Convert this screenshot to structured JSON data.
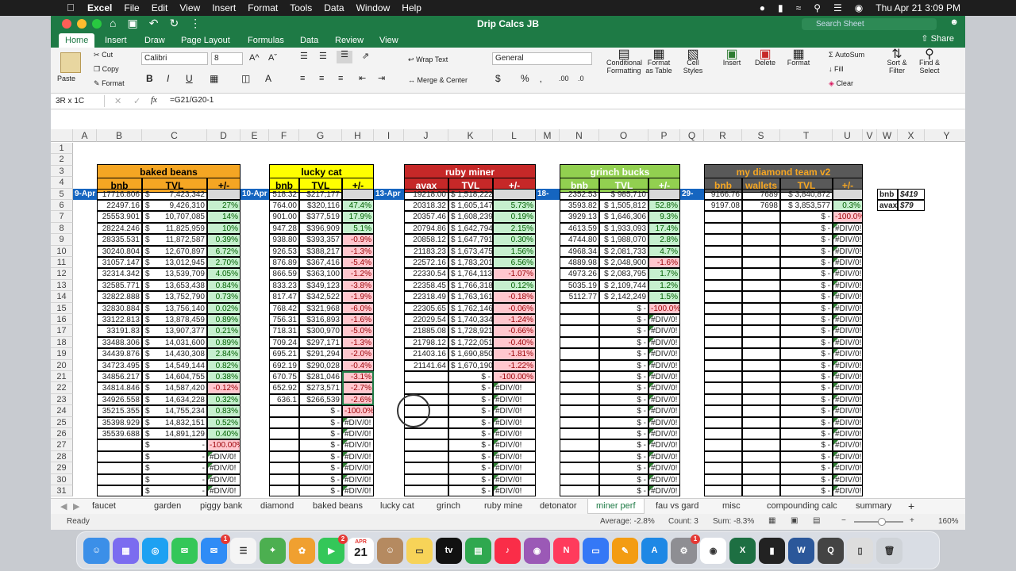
{
  "menubar": {
    "apple": "",
    "app_name": "Excel",
    "items": [
      "File",
      "Edit",
      "View",
      "Insert",
      "Format",
      "Tools",
      "Data",
      "Window",
      "Help"
    ],
    "datetime": "Thu Apr 21  3:09 PM"
  },
  "window": {
    "title": "Drip Calcs JB",
    "search_placeholder": "Search Sheet",
    "share_label": "Share"
  },
  "ribbon_tabs": [
    "Home",
    "Insert",
    "Draw",
    "Page Layout",
    "Formulas",
    "Data",
    "Review",
    "View"
  ],
  "ribbon": {
    "paste": "Paste",
    "cut": "Cut",
    "copy": "Copy",
    "format": "Format",
    "font_name": "Calibri",
    "font_size": "8",
    "wrap_text": "Wrap Text",
    "merge_center": "Merge & Center",
    "number_format": "General",
    "conditional_formatting": "Conditional Formatting",
    "format_as_table": "Format as Table",
    "cell_styles": "Cell Styles",
    "insert": "Insert",
    "delete": "Delete",
    "format2": "Format",
    "autosum": "AutoSum",
    "fill": "Fill",
    "clear": "Clear",
    "sort_filter": "Sort & Filter",
    "find_select": "Find & Select"
  },
  "formula_bar": {
    "name_box": "3R x 1C",
    "fx": "fx",
    "formula": "=G21/G20-1"
  },
  "columns": [
    "A",
    "B",
    "C",
    "D",
    "E",
    "F",
    "G",
    "H",
    "I",
    "J",
    "K",
    "L",
    "M",
    "N",
    "O",
    "P",
    "Q",
    "R",
    "S",
    "T",
    "U",
    "V",
    "W",
    "X",
    "Y"
  ],
  "rows": [
    "1",
    "2",
    "3",
    "4",
    "5",
    "6",
    "7",
    "8",
    "9",
    "10",
    "11",
    "12",
    "13",
    "14",
    "15",
    "16",
    "17",
    "18",
    "19",
    "20",
    "21",
    "22",
    "23",
    "24",
    "25",
    "26",
    "27",
    "28",
    "29",
    "30",
    "31"
  ],
  "blocks": {
    "baked_beans": {
      "title": "baked beans",
      "headers": [
        "bnb",
        "TVL",
        "+/-"
      ],
      "date": "9-Apr",
      "rows": [
        [
          "17716.806",
          "7,423,342",
          ""
        ],
        [
          "22497.16",
          "9,426,310",
          "27%"
        ],
        [
          "25553.901",
          "10,707,085",
          "14%"
        ],
        [
          "28224.246",
          "11,825,959",
          "10%"
        ],
        [
          "28335.531",
          "11,872,587",
          "0.39%"
        ],
        [
          "30240.804",
          "12,670,897",
          "6.72%"
        ],
        [
          "31057.147",
          "13,012,945",
          "2.70%"
        ],
        [
          "32314.342",
          "13,539,709",
          "4.05%"
        ],
        [
          "32585.771",
          "13,653,438",
          "0.84%"
        ],
        [
          "32822.888",
          "13,752,790",
          "0.73%"
        ],
        [
          "32830.884",
          "13,756,140",
          "0.02%"
        ],
        [
          "33122.813",
          "13,878,459",
          "0.89%"
        ],
        [
          "33191.83",
          "13,907,377",
          "0.21%"
        ],
        [
          "33488.306",
          "14,031,600",
          "0.89%"
        ],
        [
          "34439.876",
          "14,430,308",
          "2.84%"
        ],
        [
          "34723.495",
          "14,549,144",
          "0.82%"
        ],
        [
          "34856.217",
          "14,604,755",
          "0.38%"
        ],
        [
          "34814.846",
          "14,587,420",
          "-0.12%"
        ],
        [
          "34926.558",
          "14,634,228",
          "0.32%"
        ],
        [
          "35215.355",
          "14,755,234",
          "0.83%"
        ],
        [
          "35398.929",
          "14,832,151",
          "0.52%"
        ],
        [
          "35539.688",
          "14,891,129",
          "0.40%"
        ],
        [
          "",
          "-",
          "-100.00%"
        ],
        [
          "",
          "-",
          "#DIV/0!"
        ],
        [
          "",
          "-",
          "#DIV/0!"
        ],
        [
          "",
          "-",
          "#DIV/0!"
        ],
        [
          "",
          "-",
          "#DIV/0!"
        ]
      ]
    },
    "lucky_cat": {
      "title": "lucky cat",
      "headers": [
        "bnb",
        "TVL",
        "+/-"
      ],
      "date": "10-Apr",
      "rows": [
        [
          "518.32",
          "$217,177",
          ""
        ],
        [
          "764.00",
          "$320,116",
          "47.4%"
        ],
        [
          "901.00",
          "$377,519",
          "17.9%"
        ],
        [
          "947.28",
          "$396,909",
          "5.1%"
        ],
        [
          "938.80",
          "$393,357",
          "-0.9%"
        ],
        [
          "926.53",
          "$388,217",
          "-1.3%"
        ],
        [
          "876.89",
          "$367,416",
          "-5.4%"
        ],
        [
          "866.59",
          "$363,100",
          "-1.2%"
        ],
        [
          "833.23",
          "$349,123",
          "-3.8%"
        ],
        [
          "817.47",
          "$342,522",
          "-1.9%"
        ],
        [
          "768.42",
          "$321,968",
          "-6.0%"
        ],
        [
          "756.31",
          "$316,893",
          "-1.6%"
        ],
        [
          "718.31",
          "$300,970",
          "-5.0%"
        ],
        [
          "709.24",
          "$297,171",
          "-1.3%"
        ],
        [
          "695.21",
          "$291,294",
          "-2.0%"
        ],
        [
          "692.19",
          "$290,028",
          "-0.4%"
        ],
        [
          "670.75",
          "$281,046",
          "-3.1%"
        ],
        [
          "652.92",
          "$273,571",
          "-2.7%"
        ],
        [
          "636.1",
          "$266,539",
          "-2.6%"
        ],
        [
          "",
          "$ -",
          "-100.0%"
        ],
        [
          "",
          "$ -",
          "#DIV/0!"
        ],
        [
          "",
          "$ -",
          "#DIV/0!"
        ],
        [
          "",
          "$ -",
          "#DIV/0!"
        ],
        [
          "",
          "$ -",
          "#DIV/0!"
        ],
        [
          "",
          "$ -",
          "#DIV/0!"
        ],
        [
          "",
          "$ -",
          "#DIV/0!"
        ],
        [
          "",
          "$ -",
          "#DIV/0!"
        ]
      ]
    },
    "ruby_miner": {
      "title": "ruby miner",
      "headers": [
        "avax",
        "TVL",
        "+/-"
      ],
      "date": "13-Apr",
      "rows": [
        [
          "19218.00",
          "$ 1,518,222",
          ""
        ],
        [
          "20318.32",
          "$ 1,605,147",
          "5.73%"
        ],
        [
          "20357.46",
          "$ 1,608,239",
          "0.19%"
        ],
        [
          "20794.86",
          "$ 1,642,794",
          "2.15%"
        ],
        [
          "20858.12",
          "$ 1,647,791",
          "0.30%"
        ],
        [
          "21183.23",
          "$ 1,673,475",
          "1.56%"
        ],
        [
          "22572.16",
          "$ 1,783,201",
          "6.56%"
        ],
        [
          "22330.54",
          "$ 1,764,113",
          "-1.07%"
        ],
        [
          "22358.45",
          "$ 1,766,318",
          "0.12%"
        ],
        [
          "22318.49",
          "$ 1,763,161",
          "-0.18%"
        ],
        [
          "22305.65",
          "$ 1,762,146",
          "-0.06%"
        ],
        [
          "22029.54",
          "$ 1,740,334",
          "-1.24%"
        ],
        [
          "21885.08",
          "$ 1,728,921",
          "-0.66%"
        ],
        [
          "21798.12",
          "$ 1,722,051",
          "-0.40%"
        ],
        [
          "21403.16",
          "$ 1,690,850",
          "-1.81%"
        ],
        [
          "21141.64",
          "$ 1,670,190",
          "-1.22%"
        ],
        [
          "",
          "$ -",
          "-100.00%"
        ],
        [
          "",
          "$ -",
          "#DIV/0!"
        ],
        [
          "",
          "$ -",
          "#DIV/0!"
        ],
        [
          "",
          "$ -",
          "#DIV/0!"
        ],
        [
          "",
          "$ -",
          "#DIV/0!"
        ],
        [
          "",
          "$ -",
          "#DIV/0!"
        ],
        [
          "",
          "$ -",
          "#DIV/0!"
        ],
        [
          "",
          "$ -",
          "#DIV/0!"
        ],
        [
          "",
          "$ -",
          "#DIV/0!"
        ],
        [
          "",
          "$ -",
          "#DIV/0!"
        ],
        [
          "",
          "$ -",
          "#DIV/0!"
        ]
      ]
    },
    "grinch_bucks": {
      "title": "grinch bucks",
      "headers": [
        "bnb",
        "TVL",
        "+/-"
      ],
      "date": "18-Apr",
      "rows": [
        [
          "2352.53",
          "$ 985,710",
          ""
        ],
        [
          "3593.82",
          "$ 1,505,812",
          "52.8%"
        ],
        [
          "3929.13",
          "$ 1,646,306",
          "9.3%"
        ],
        [
          "4613.59",
          "$ 1,933,093",
          "17.4%"
        ],
        [
          "4744.80",
          "$ 1,988,070",
          "2.8%"
        ],
        [
          "4968.34",
          "$ 2,081,733",
          "4.7%"
        ],
        [
          "4889.98",
          "$ 2,048,900",
          "-1.6%"
        ],
        [
          "4973.26",
          "$ 2,083,795",
          "1.7%"
        ],
        [
          "5035.19",
          "$ 2,109,744",
          "1.2%"
        ],
        [
          "5112.77",
          "$ 2,142,249",
          "1.5%"
        ],
        [
          "",
          "$ -",
          "-100.0%"
        ],
        [
          "",
          "$ -",
          "#DIV/0!"
        ],
        [
          "",
          "$ -",
          "#DIV/0!"
        ],
        [
          "",
          "$ -",
          "#DIV/0!"
        ],
        [
          "",
          "$ -",
          "#DIV/0!"
        ],
        [
          "",
          "$ -",
          "#DIV/0!"
        ],
        [
          "",
          "$ -",
          "#DIV/0!"
        ],
        [
          "",
          "$ -",
          "#DIV/0!"
        ],
        [
          "",
          "$ -",
          "#DIV/0!"
        ],
        [
          "",
          "$ -",
          "#DIV/0!"
        ],
        [
          "",
          "$ -",
          "#DIV/0!"
        ],
        [
          "",
          "$ -",
          "#DIV/0!"
        ],
        [
          "",
          "$ -",
          "#DIV/0!"
        ],
        [
          "",
          "$ -",
          "#DIV/0!"
        ],
        [
          "",
          "$ -",
          "#DIV/0!"
        ],
        [
          "",
          "$ -",
          "#DIV/0!"
        ],
        [
          "",
          "$ -",
          "#DIV/0!"
        ]
      ]
    },
    "diamond_team": {
      "title": "my diamond team v2",
      "headers": [
        "bnb",
        "wallets",
        "TVL",
        "+/-"
      ],
      "date": "29-Mar",
      "rows": [
        [
          "9166.76",
          "7689",
          "$ 3,840,872",
          ""
        ],
        [
          "9197.08",
          "7698",
          "$ 3,853,577",
          "0.3%"
        ],
        [
          "",
          "",
          "$ -",
          "-100.0%"
        ],
        [
          "",
          "",
          "$ -",
          "#DIV/0!"
        ],
        [
          "",
          "",
          "$ -",
          "#DIV/0!"
        ],
        [
          "",
          "",
          "$ -",
          "#DIV/0!"
        ],
        [
          "",
          "",
          "$ -",
          "#DIV/0!"
        ],
        [
          "",
          "",
          "$ -",
          "#DIV/0!"
        ],
        [
          "",
          "",
          "$ -",
          "#DIV/0!"
        ],
        [
          "",
          "",
          "$ -",
          "#DIV/0!"
        ],
        [
          "",
          "",
          "$ -",
          "#DIV/0!"
        ],
        [
          "",
          "",
          "$ -",
          "#DIV/0!"
        ],
        [
          "",
          "",
          "$ -",
          "#DIV/0!"
        ],
        [
          "",
          "",
          "$ -",
          "#DIV/0!"
        ],
        [
          "",
          "",
          "$ -",
          "#DIV/0!"
        ],
        [
          "",
          "",
          "$ -",
          "#DIV/0!"
        ],
        [
          "",
          "",
          "$ -",
          "#DIV/0!"
        ],
        [
          "",
          "",
          "$ -",
          "#DIV/0!"
        ],
        [
          "",
          "",
          "$ -",
          "#DIV/0!"
        ],
        [
          "",
          "",
          "$ -",
          "#DIV/0!"
        ],
        [
          "",
          "",
          "$ -",
          "#DIV/0!"
        ],
        [
          "",
          "",
          "$ -",
          "#DIV/0!"
        ],
        [
          "",
          "",
          "$ -",
          "#DIV/0!"
        ],
        [
          "",
          "",
          "$ -",
          "#DIV/0!"
        ],
        [
          "",
          "",
          "$ -",
          "#DIV/0!"
        ],
        [
          "",
          "",
          "$ -",
          "#DIV/0!"
        ],
        [
          "",
          "",
          "$ -",
          "#DIV/0!"
        ]
      ]
    },
    "prices": [
      [
        "bnb",
        "$419"
      ],
      [
        "avax",
        "$79"
      ]
    ]
  },
  "sheet_tabs": [
    "faucet",
    "garden",
    "piggy bank",
    "diamond",
    "baked beans",
    "lucky cat",
    "grinch",
    "ruby mine",
    "detonator",
    "miner perf",
    "fau vs gard",
    "misc",
    "compounding calc",
    "summary"
  ],
  "active_sheet": "miner perf",
  "status": {
    "ready": "Ready",
    "average": "Average: -2.8%",
    "count": "Count: 3",
    "sum": "Sum: -8.3%",
    "zoom": "160%"
  },
  "dock_apps": [
    "Finder",
    "Launchpad",
    "Safari",
    "Messages",
    "Mail",
    "Reminders",
    "Maps",
    "Photos",
    "FaceTime",
    "Calendar",
    "Contacts",
    "Notes",
    "TV",
    "Numbers",
    "Music",
    "Podcasts",
    "News",
    "Keynote",
    "Pages",
    "App Store",
    "System Preferences",
    "Chrome",
    "Excel",
    "Terminal",
    "Word",
    "QuickTime",
    "Preview",
    "Trash"
  ],
  "dock_calendar": {
    "month": "APR",
    "day": "21"
  },
  "colors": {
    "accent": "#1e7a45",
    "date_blue": "#1565c0",
    "orange": "#f5a623",
    "yellow": "#ffff00",
    "red": "#c62828",
    "green": "#92d050",
    "gray": "#595959",
    "pos_fill": "#c6efce",
    "neg_fill": "#ffc7ce"
  }
}
